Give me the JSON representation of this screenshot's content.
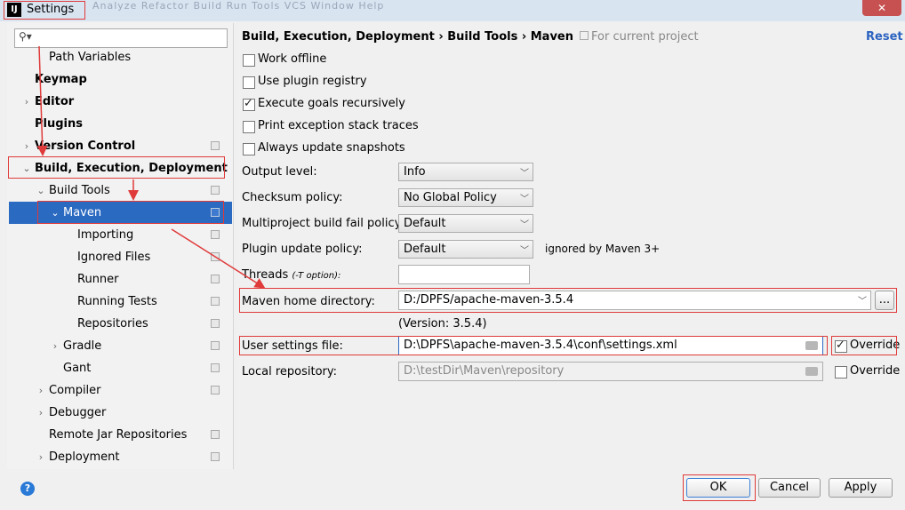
{
  "window": {
    "title": "Settings",
    "app_icon": "IJ",
    "ghost_menu": "Analyze  Refactor  Build  Run  Tools  VCS  Window  Help"
  },
  "sidebar": {
    "items": [
      {
        "label": "Path Variables",
        "bold": false,
        "arrow": "",
        "project_icon": false
      },
      {
        "label": "Keymap",
        "bold": true,
        "arrow": "",
        "project_icon": false
      },
      {
        "label": "Editor",
        "bold": true,
        "arrow": ">",
        "project_icon": false
      },
      {
        "label": "Plugins",
        "bold": true,
        "arrow": "",
        "project_icon": false
      },
      {
        "label": "Version Control",
        "bold": true,
        "arrow": ">",
        "project_icon": true
      },
      {
        "label": "Build, Execution, Deployment",
        "bold": true,
        "arrow": "v",
        "project_icon": false
      },
      {
        "label": "Build Tools",
        "bold": false,
        "arrow": "v",
        "project_icon": true
      },
      {
        "label": "Maven",
        "bold": false,
        "arrow": "v",
        "project_icon": true,
        "selected": true
      },
      {
        "label": "Importing",
        "bold": false,
        "arrow": "",
        "project_icon": true
      },
      {
        "label": "Ignored Files",
        "bold": false,
        "arrow": "",
        "project_icon": true
      },
      {
        "label": "Runner",
        "bold": false,
        "arrow": "",
        "project_icon": true
      },
      {
        "label": "Running Tests",
        "bold": false,
        "arrow": "",
        "project_icon": true
      },
      {
        "label": "Repositories",
        "bold": false,
        "arrow": "",
        "project_icon": true
      },
      {
        "label": "Gradle",
        "bold": false,
        "arrow": ">",
        "project_icon": true
      },
      {
        "label": "Gant",
        "bold": false,
        "arrow": "",
        "project_icon": true
      },
      {
        "label": "Compiler",
        "bold": false,
        "arrow": ">",
        "project_icon": true
      },
      {
        "label": "Debugger",
        "bold": false,
        "arrow": ">",
        "project_icon": false
      },
      {
        "label": "Remote Jar Repositories",
        "bold": false,
        "arrow": "",
        "project_icon": true
      },
      {
        "label": "Deployment",
        "bold": false,
        "arrow": ">",
        "project_icon": true
      }
    ]
  },
  "header": {
    "breadcrumb": "Build, Execution, Deployment  ›  Build Tools  ›  Maven",
    "for_project": "For current project",
    "reset": "Reset"
  },
  "checkboxes": [
    {
      "label": "Work offline",
      "checked": false
    },
    {
      "label": "Use plugin registry",
      "checked": false
    },
    {
      "label": "Execute goals recursively",
      "checked": true
    },
    {
      "label": "Print exception stack traces",
      "checked": false
    },
    {
      "label": "Always update snapshots",
      "checked": false
    }
  ],
  "form": {
    "output_level": {
      "label": "Output level:",
      "value": "Info"
    },
    "checksum_policy": {
      "label": "Checksum policy:",
      "value": "No Global Policy"
    },
    "fail_policy": {
      "label": "Multiproject build fail policy:",
      "value": "Default"
    },
    "update_policy": {
      "label": "Plugin update policy:",
      "value": "Default",
      "note": "ignored by Maven 3+"
    },
    "threads": {
      "label": "Threads",
      "hint": "(-T option):",
      "value": ""
    },
    "maven_home": {
      "label": "Maven home directory:",
      "value": "D:/DPFS/apache-maven-3.5.4",
      "browse": "...",
      "version": "(Version: 3.5.4)"
    },
    "user_settings": {
      "label": "User settings file:",
      "value": "D:\\DPFS\\apache-maven-3.5.4\\conf\\settings.xml",
      "override_label": "Override",
      "override": true
    },
    "local_repo": {
      "label": "Local repository:",
      "value": "D:\\testDir\\Maven\\repository",
      "override_label": "Override",
      "override": false
    }
  },
  "buttons": {
    "ok": "OK",
    "cancel": "Cancel",
    "apply": "Apply",
    "help": "?"
  },
  "colors": {
    "selection": "#2b6ac1",
    "annotation": "#e03a3a",
    "link": "#2c63c0"
  }
}
